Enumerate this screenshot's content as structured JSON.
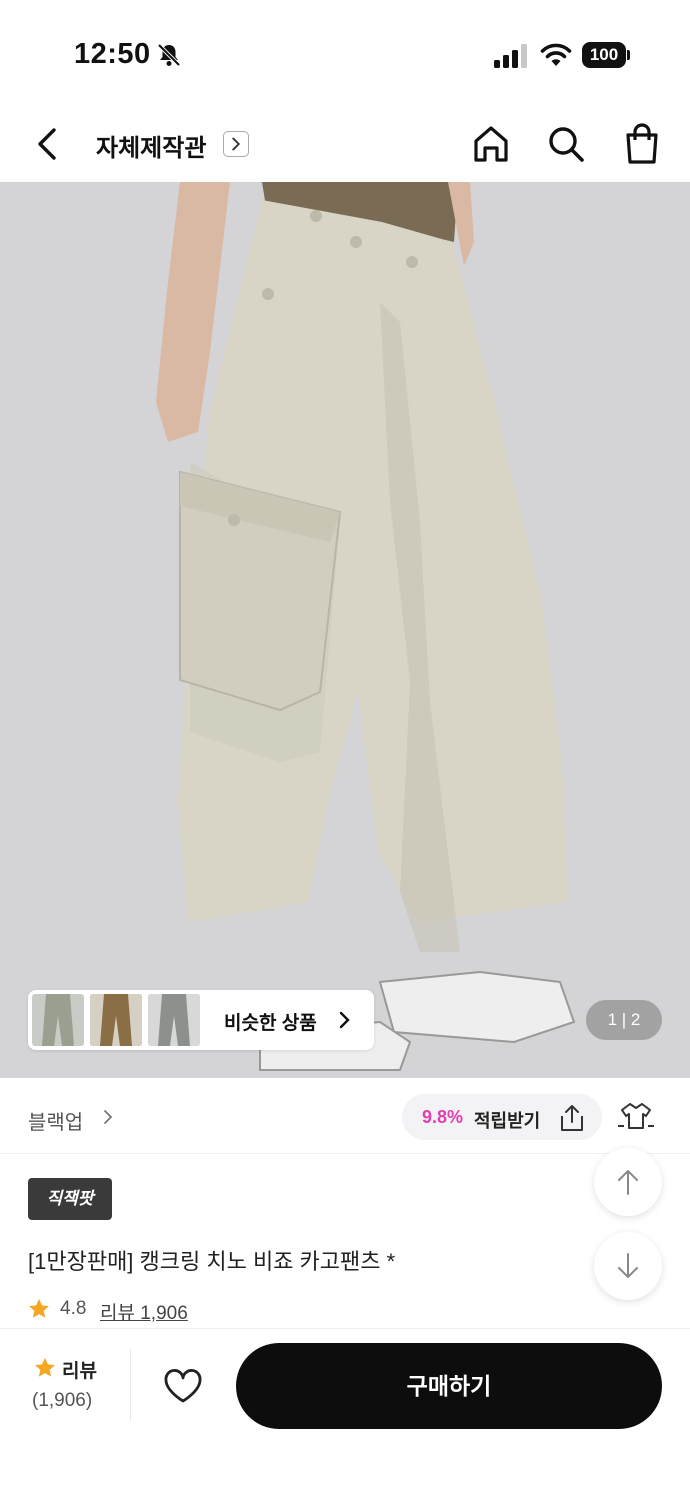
{
  "status_bar": {
    "time": "12:50",
    "battery": "100",
    "icons": [
      "bell-slash-icon",
      "signal-icon",
      "wifi-icon",
      "battery-icon"
    ]
  },
  "nav": {
    "title": "자체제작관",
    "icons": [
      "chevron-left-icon",
      "chevron-right-icon",
      "home-icon",
      "search-icon",
      "shopping-bag-icon"
    ]
  },
  "hero": {
    "similar_label": "비슷한 상품",
    "page_indicator": "1 | 2",
    "colors": {
      "background": "#d4d4d6",
      "pants": "#d8d5c7"
    }
  },
  "brand_row": {
    "brand_name": "블랙업",
    "points_percent": "9.8%",
    "points_label": "적립받기",
    "icons": [
      "share-icon",
      "outfit-icon"
    ]
  },
  "product": {
    "badge": "직잭팟",
    "title": "[1만장판매] 캥크링 치노 비죠 카고팬츠 *",
    "rating": "4.8",
    "review_link": "리뷰 1,906"
  },
  "bottom_bar": {
    "review_label": "리뷰",
    "review_count": "(1,906)",
    "buy_label": "구매하기",
    "accent_color": "#f5a623",
    "button_color": "#0d0d0d"
  }
}
